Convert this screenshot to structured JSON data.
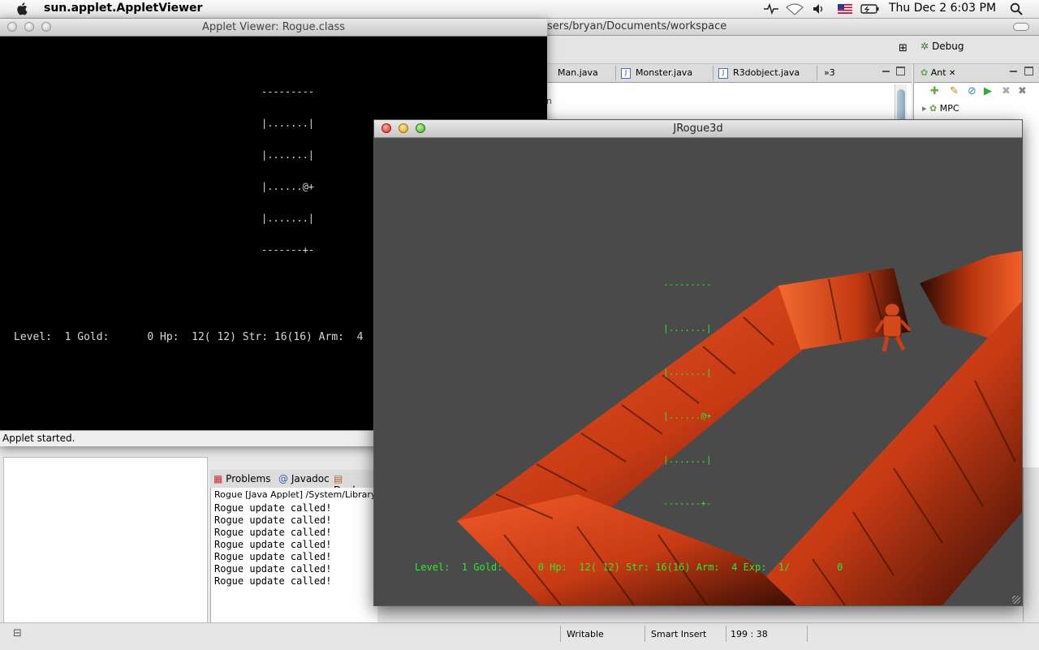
{
  "menubar": {
    "app_name": "sun.applet.AppletViewer",
    "clock": "Thu Dec 2  6:03 PM"
  },
  "eclipse": {
    "title_path": "sers/bryan/Documents/workspace",
    "perspective": "Debug",
    "editor_tabs": [
      {
        "label": "Man.java"
      },
      {
        "label": "Monster.java"
      },
      {
        "label": "R3dobject.java"
      }
    ],
    "overflow_tabs": "»3",
    "editor_fragment": "n",
    "ant_view": {
      "title": "Ant",
      "tree_item": "MPC"
    },
    "console_tabs": [
      "Problems",
      "Javadoc",
      "Declar"
    ],
    "console_header": "Rogue [Java Applet] /System/Library/",
    "console_lines": [
      "Rogue update called!",
      "Rogue update called!",
      "Rogue update called!",
      "Rogue update called!",
      "Rogue update called!",
      "Rogue update called!",
      "Rogue update called!"
    ],
    "status": {
      "writable": "Writable",
      "insert_mode": "Smart Insert",
      "position": "199 : 38"
    }
  },
  "applet_window": {
    "title": "Applet Viewer: Rogue.class",
    "map_lines": [
      "---------",
      "|.......|",
      "|.......|",
      "|......@+",
      "|.......|",
      "-------+-"
    ],
    "stats_line": "Level:  1 Gold:      0 Hp:  12( 12) Str: 16(16) Arm:  4",
    "status_text": "Applet started."
  },
  "jrogue_window": {
    "title": "JRogue3d",
    "map_lines": [
      "---------",
      "|.......|",
      "|.......|",
      "|......@+",
      "|.......|",
      "-------+-"
    ],
    "stats_line": "Level:  1 Gold:      0 Hp:  12( 12) Str: 16(16) Arm:  4 Exp:  1/        0",
    "wall_color": "#e0461e",
    "floor_color": "#4a4a4a",
    "hud_color": "#2ee82e"
  }
}
